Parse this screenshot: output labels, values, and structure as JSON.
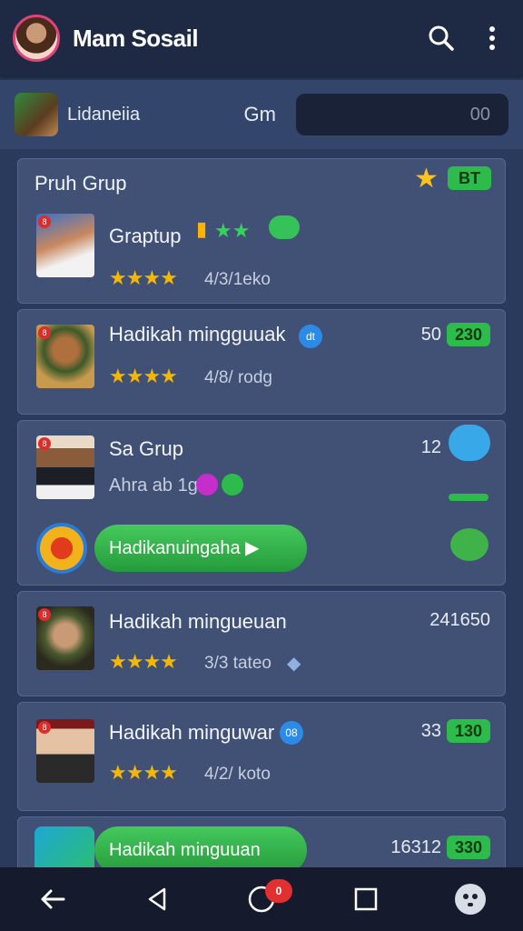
{
  "app_bar": {
    "title": "Mam Sosail"
  },
  "filter": {
    "label": "Lidaneiia",
    "gm": "Gm",
    "input_value": "00"
  },
  "groups": [
    {
      "title": "Pruh Grup",
      "name": "Graptup",
      "stars": "★★★★",
      "rating": "4/3/1eko",
      "badge": "BT"
    },
    {
      "name": "Hadikah mingguuak",
      "dot": "dt",
      "stars": "★★★★",
      "rating": "4/8/ rodg",
      "count": "50",
      "badge": "230"
    },
    {
      "name": "Sa Grup",
      "sub": "Ahra ab 1g",
      "count": "12",
      "button": "Hadikanuingaha ▶"
    },
    {
      "name": "Hadikah mingueuan",
      "stars": "★★★★",
      "rating": "3/3 tateo",
      "count": "241650"
    },
    {
      "name": "Hadikah minguwar",
      "dot": "08",
      "stars": "★★★★",
      "rating": "4/2/ koto",
      "count": "33",
      "badge": "130"
    },
    {
      "button": "Hadikah minguuan",
      "count": "16312",
      "badge": "330"
    }
  ],
  "nav": {
    "badge": "0"
  },
  "colors": {
    "accent_green": "#2dbb4b",
    "card": "#415176",
    "app_bar": "#1e2a44",
    "badge_red": "#e02b2b",
    "star": "#f5b800"
  }
}
